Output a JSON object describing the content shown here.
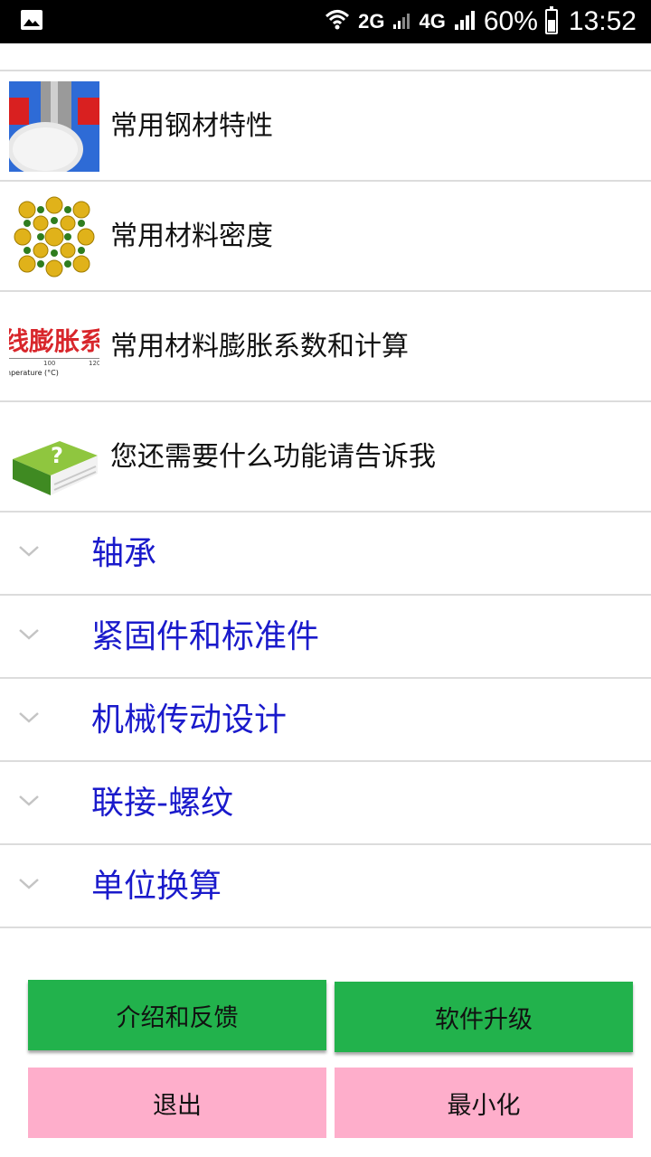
{
  "status_bar": {
    "network_2g": "2G",
    "network_4g": "4G",
    "battery_percent": "60%",
    "battery_level": 0.6,
    "time": "13:52"
  },
  "list": {
    "items": [
      {
        "label": "常用钢材特性",
        "icon": "steel-bar-icon"
      },
      {
        "label": "常用材料密度",
        "icon": "crystal-lattice-icon"
      },
      {
        "label": "常用材料膨胀系数和计算",
        "icon": "expansion-chart-icon",
        "thumb_text": "线膨胀系",
        "thumb_axis_label": "nperature (°C)",
        "thumb_ticks": [
          "100",
          "120"
        ]
      },
      {
        "label": "您还需要什么功能请告诉我",
        "icon": "help-book-icon"
      }
    ]
  },
  "sections": [
    {
      "label": "轴承"
    },
    {
      "label": "紧固件和标准件"
    },
    {
      "label": "机械传动设计"
    },
    {
      "label": "联接-螺纹"
    },
    {
      "label": "单位换算"
    }
  ],
  "buttons": {
    "feedback": "介绍和反馈",
    "upgrade": "软件升级",
    "exit": "退出",
    "minimize": "最小化"
  },
  "colors": {
    "section_text": "#1a1acb",
    "green_button": "#22b24c",
    "pink_button": "#feaecb"
  }
}
